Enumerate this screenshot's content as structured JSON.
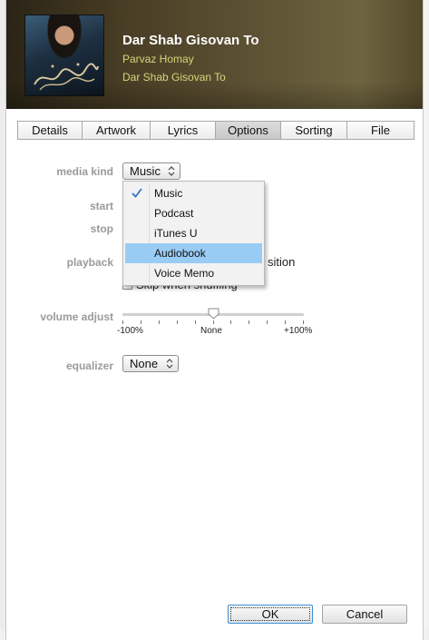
{
  "header": {
    "title": "Dar Shab Gisovan To",
    "artist": "Parvaz Homay",
    "album": "Dar Shab Gisovan To"
  },
  "tabs": [
    {
      "label": "Details",
      "active": false
    },
    {
      "label": "Artwork",
      "active": false
    },
    {
      "label": "Lyrics",
      "active": false
    },
    {
      "label": "Options",
      "active": true
    },
    {
      "label": "Sorting",
      "active": false
    },
    {
      "label": "File",
      "active": false
    }
  ],
  "options": {
    "media_kind_label": "media kind",
    "media_kind_value": "Music",
    "start_label": "start",
    "stop_label": "stop",
    "playback_label": "playback",
    "remember_position_text": "sition",
    "skip_shuffling_text": "Skip when shuffling",
    "volume_label": "volume adjust",
    "volume_min": "-100%",
    "volume_mid": "None",
    "volume_max": "+100%",
    "volume_level_percent": 0,
    "equalizer_label": "equalizer",
    "equalizer_value": "None"
  },
  "media_kind_menu": {
    "items": [
      "Music",
      "Podcast",
      "iTunes U",
      "Audiobook",
      "Voice Memo"
    ],
    "checked": "Music",
    "highlighted": "Audiobook"
  },
  "footer": {
    "ok_label": "OK",
    "cancel_label": "Cancel"
  },
  "colors": {
    "artist_text": "#d9d37a",
    "menu_highlight": "#99ccf5",
    "check_mark": "#2f78c8",
    "label_gray": "#9a9a9a"
  },
  "icons": {
    "check": "check-icon",
    "dropdown": "chevron-updown-icon"
  }
}
